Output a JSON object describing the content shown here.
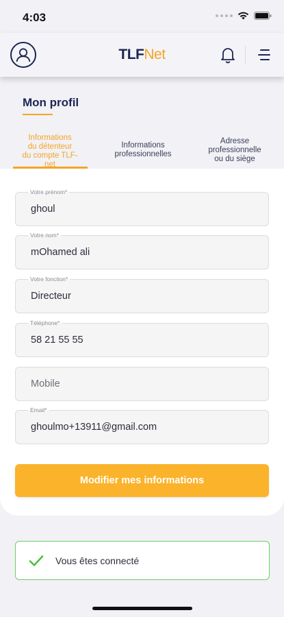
{
  "status_bar": {
    "time": "4:03"
  },
  "header": {
    "logo_part1": "TLF",
    "logo_part2": "Net"
  },
  "page": {
    "title": "Mon profil"
  },
  "tabs": [
    {
      "label_lines": [
        "Informations",
        "du détenteur",
        "du compte TLF-",
        "net"
      ],
      "active": true
    },
    {
      "label_lines": [
        "Informations",
        "professionnelles"
      ],
      "active": false
    },
    {
      "label_lines": [
        "Adresse",
        "professionnelle",
        "ou du siège"
      ],
      "active": false
    }
  ],
  "form": {
    "first_name": {
      "label": "Votre prénom*",
      "value": "ghoul"
    },
    "last_name": {
      "label": "Votre nom*",
      "value": "mOhamed ali"
    },
    "function": {
      "label": "Votre fonction*",
      "value": "Directeur"
    },
    "phone": {
      "label": "Téléphone*",
      "value": "58 21 55 55"
    },
    "mobile": {
      "placeholder": "Mobile"
    },
    "email": {
      "label": "Email*",
      "value": "ghoulmo+13911@gmail.com"
    },
    "submit_label": "Modifier mes informations"
  },
  "toast": {
    "message": "Vous êtes connecté"
  },
  "colors": {
    "accent": "#f5a524",
    "brand_navy": "#1c2552",
    "button": "#fbb32b",
    "success": "#4bc23f"
  },
  "icons": [
    "profile-icon",
    "bell-icon",
    "menu-icon",
    "check-icon",
    "wifi-icon",
    "battery-icon"
  ]
}
